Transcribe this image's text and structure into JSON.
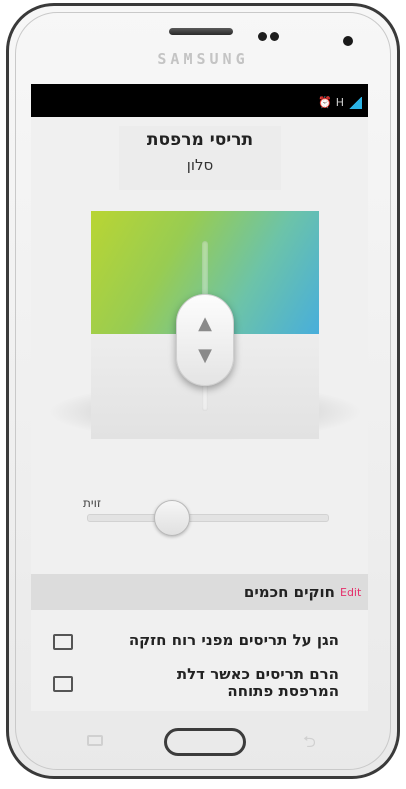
{
  "device": {
    "brand": "SAMSUNG"
  },
  "status_bar": {
    "icons": [
      "alarm-icon",
      "network-type-icon",
      "signal-icon"
    ],
    "network_label": "H"
  },
  "header": {
    "device_name": "תריסי מרפסת",
    "room": "סלון"
  },
  "shade": {
    "colors": {
      "gradient_start": "#b9d533",
      "gradient_end": "#48aedb",
      "lower_panel": "#e6e6e6"
    },
    "up_icon": "▲",
    "down_icon": "▼"
  },
  "angle": {
    "label": "זוית"
  },
  "rules": {
    "title": "חוקים חכמים",
    "edit_label": "Edit",
    "edit_color": "#e5306b",
    "items": [
      {
        "text": "הגן על תריסים מפני רוח חזקה",
        "icon": "window-icon"
      },
      {
        "text": "הרם תריסים כאשר דלת המרפסת פתוחה",
        "icon": "door-icon"
      }
    ]
  },
  "nav": {
    "recent": "recent-apps-icon",
    "home": "home-button",
    "back": "back-icon"
  }
}
